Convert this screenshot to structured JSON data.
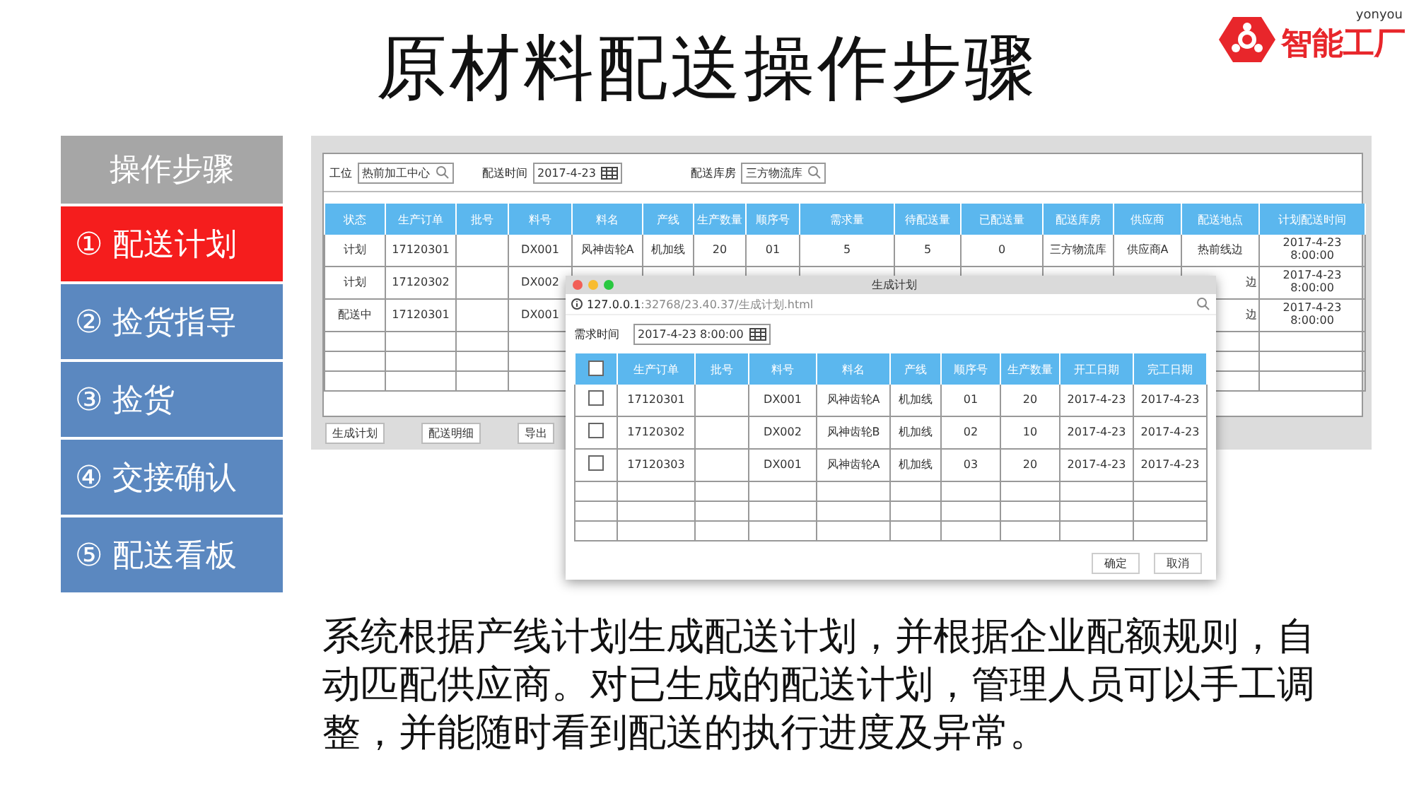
{
  "title": "原材料配送操作步骤",
  "logo": {
    "brand": "yonyou",
    "name": "智能工厂"
  },
  "steps": {
    "header": "操作步骤",
    "items": [
      {
        "label": "① 配送计划",
        "selected": true
      },
      {
        "label": "② 捡货指导",
        "selected": false
      },
      {
        "label": "③ 捡货",
        "selected": false
      },
      {
        "label": "④ 交接确认",
        "selected": false
      },
      {
        "label": "⑤ 配送看板",
        "selected": false
      }
    ]
  },
  "app": {
    "filters": [
      {
        "label": "工位",
        "value": "热前加工中心",
        "kind": "search"
      },
      {
        "label": "配送时间",
        "value": "2017-4-23",
        "kind": "date"
      },
      {
        "label": "配送库房",
        "value": "三方物流库",
        "kind": "search"
      }
    ],
    "table": {
      "columns": [
        "状态",
        "生产订单",
        "批号",
        "料号",
        "料名",
        "产线",
        "生产数量",
        "顺序号",
        "需求量",
        "待配送量",
        "已配送量",
        "配送库房",
        "供应商",
        "配送地点",
        "计划配送时间"
      ],
      "rows": [
        {
          "cells": [
            "计划",
            "17120301",
            "",
            "DX001",
            "风神齿轮A",
            "机加线",
            "20",
            "01",
            "5",
            "5",
            "0",
            "三方物流库",
            "供应商A",
            "热前线边",
            "2017-4-23 8:00:00"
          ]
        },
        {
          "cells": [
            "计划",
            "17120302",
            "",
            "DX002",
            "",
            "",
            "",
            "",
            "",
            "",
            "",
            "",
            "",
            "边",
            "2017-4-23 8:00:00"
          ]
        },
        {
          "cells": [
            "配送中",
            "17120301",
            "",
            "DX001",
            "",
            "",
            "",
            "",
            "",
            "",
            "",
            "",
            "",
            "边",
            "2017-4-23 8:00:00"
          ]
        }
      ]
    },
    "buttons": [
      "生成计划",
      "配送明细",
      "导出"
    ]
  },
  "dialog": {
    "title": "生成计划",
    "url_host": "127.0.0.1",
    "url_rest": ":32768/23.40.37/生成计划.html",
    "field": {
      "label": "需求时间",
      "value": "2017-4-23 8:00:00"
    },
    "header_checked": false,
    "columns": [
      "生产订单",
      "批号",
      "料号",
      "料名",
      "产线",
      "顺序号",
      "生产数量",
      "开工日期",
      "完工日期"
    ],
    "rows": [
      {
        "checked": false,
        "cells": [
          "17120301",
          "",
          "DX001",
          "风神齿轮A",
          "机加线",
          "01",
          "20",
          "2017-4-23",
          "2017-4-23"
        ]
      },
      {
        "checked": false,
        "cells": [
          "17120302",
          "",
          "DX002",
          "风神齿轮B",
          "机加线",
          "02",
          "10",
          "2017-4-23",
          "2017-4-23"
        ]
      },
      {
        "checked": false,
        "cells": [
          "17120303",
          "",
          "DX001",
          "风神齿轮A",
          "机加线",
          "03",
          "20",
          "2017-4-23",
          "2017-4-23"
        ]
      }
    ],
    "buttons": [
      "确定",
      "取消"
    ]
  },
  "description": "系统根据产线计划生成配送计划，并根据企业配额规则，自动匹配供应商。对已生成的配送计划，管理人员可以手工调整，并能随时看到配送的执行进度及异常。"
}
